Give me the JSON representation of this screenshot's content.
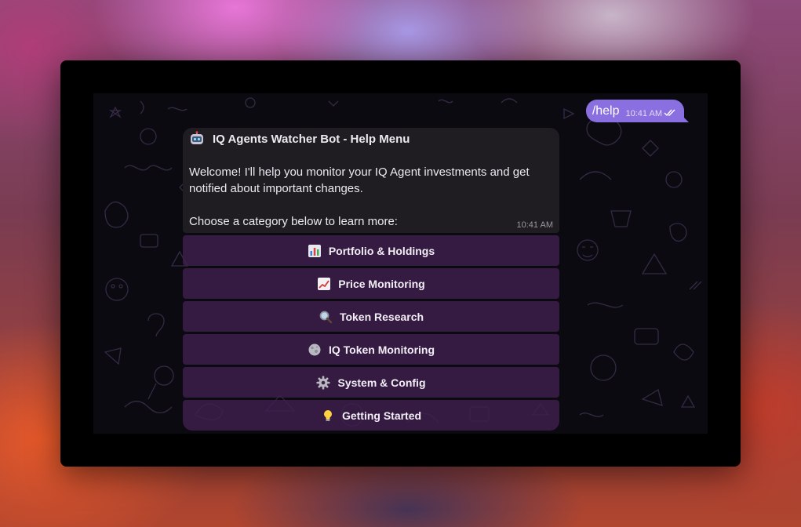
{
  "outgoing": {
    "text": "/help",
    "time": "10:41 AM",
    "status_icon": "double-check-icon"
  },
  "bot_message": {
    "icon": "robot-icon",
    "title": "IQ Agents Watcher Bot - Help Menu",
    "welcome": "Welcome! I'll help you monitor your IQ Agent investments and get notified about important changes.",
    "prompt": "Choose a category below to learn more:",
    "time": "10:41 AM"
  },
  "keyboard": {
    "buttons": [
      {
        "label": "Portfolio & Holdings",
        "icon": "bar-chart-icon"
      },
      {
        "label": "Price Monitoring",
        "icon": "trend-chart-icon"
      },
      {
        "label": "Token Research",
        "icon": "magnifier-icon"
      },
      {
        "label": "IQ Token Monitoring",
        "icon": "moon-icon"
      },
      {
        "label": "System & Config",
        "icon": "gear-icon"
      },
      {
        "label": "Getting Started",
        "icon": "lightbulb-icon"
      }
    ]
  },
  "colors": {
    "outgoing_bubble": "#8a6fe0",
    "bot_bubble": "#1f1d22",
    "keyboard_button": "#3e204e",
    "chat_background": "#0b0a10"
  }
}
